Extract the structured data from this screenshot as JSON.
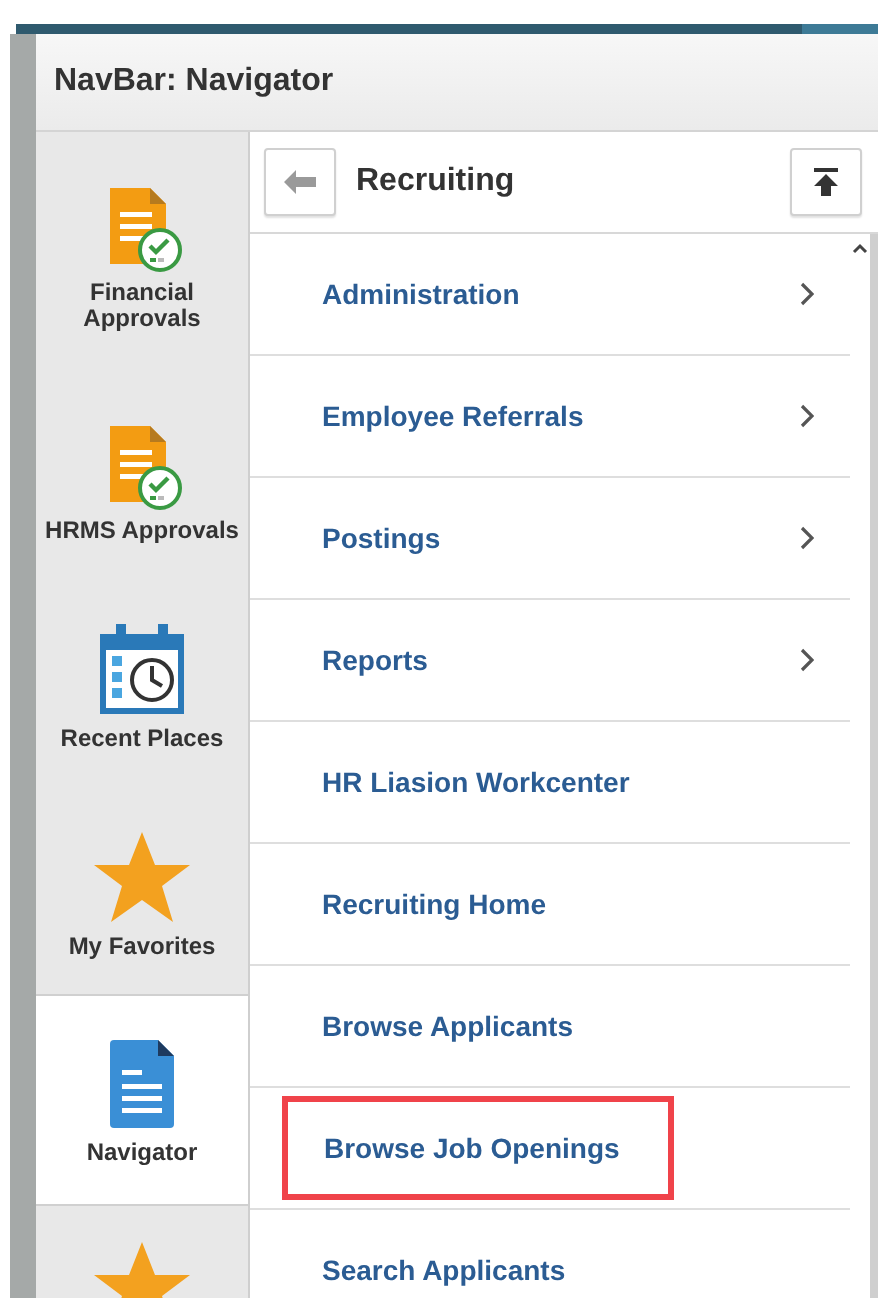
{
  "panel": {
    "title": "NavBar: Navigator"
  },
  "sidebar": {
    "items": [
      {
        "label": "Financial Approvals",
        "kind": "approvals",
        "selected": false
      },
      {
        "label": "HRMS Approvals",
        "kind": "approvals",
        "selected": false
      },
      {
        "label": "Recent Places",
        "kind": "recent",
        "selected": false
      },
      {
        "label": "My Favorites",
        "kind": "favorites",
        "selected": false
      },
      {
        "label": "Navigator",
        "kind": "navigator",
        "selected": true
      },
      {
        "kind": "favorites",
        "selected": false
      }
    ]
  },
  "navigator": {
    "title": "Recruiting",
    "items": [
      {
        "label": "Administration",
        "has_children": true,
        "highlighted": false
      },
      {
        "label": "Employee Referrals",
        "has_children": true,
        "highlighted": false
      },
      {
        "label": "Postings",
        "has_children": true,
        "highlighted": false
      },
      {
        "label": "Reports",
        "has_children": true,
        "highlighted": false
      },
      {
        "label": "HR Liasion Workcenter",
        "has_children": false,
        "highlighted": false
      },
      {
        "label": "Recruiting Home",
        "has_children": false,
        "highlighted": false
      },
      {
        "label": "Browse Applicants",
        "has_children": false,
        "highlighted": false
      },
      {
        "label": "Browse Job Openings",
        "has_children": false,
        "highlighted": true
      },
      {
        "label": "Search Applicants",
        "has_children": false,
        "highlighted": false
      }
    ]
  }
}
